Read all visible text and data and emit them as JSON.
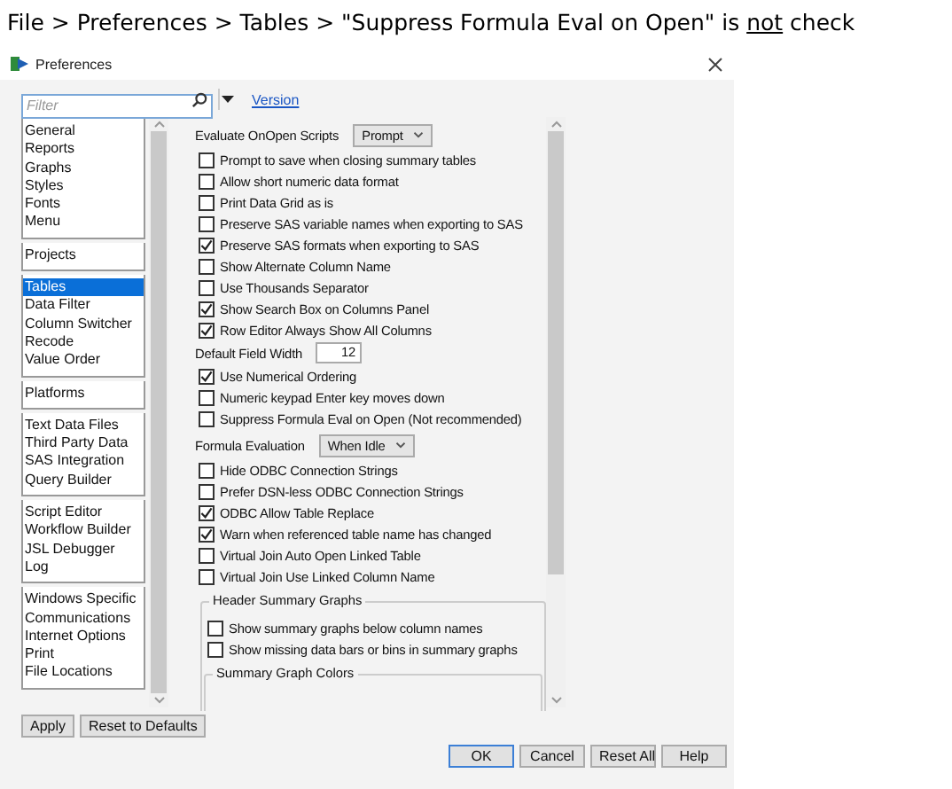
{
  "caption": {
    "before": "File > Preferences > Tables > \"Suppress Formula Eval on Open\" is ",
    "underlined": "not",
    "after": " check"
  },
  "window": {
    "title": "Preferences"
  },
  "filter": {
    "placeholder": "Filter"
  },
  "version_link": "Version",
  "sidebar": {
    "groups": [
      [
        {
          "label": "General",
          "selected": false
        },
        {
          "label": "Reports",
          "selected": false
        },
        {
          "label": "Graphs",
          "selected": false
        },
        {
          "label": "Styles",
          "selected": false
        },
        {
          "label": "Fonts",
          "selected": false
        },
        {
          "label": "Menu",
          "selected": false
        }
      ],
      [
        {
          "label": "Projects",
          "selected": false
        }
      ],
      [
        {
          "label": "Tables",
          "selected": true
        },
        {
          "label": "Data Filter",
          "selected": false
        },
        {
          "label": "Column Switcher",
          "selected": false
        },
        {
          "label": "Recode",
          "selected": false
        },
        {
          "label": "Value Order",
          "selected": false
        }
      ],
      [
        {
          "label": "Platforms",
          "selected": false
        }
      ],
      [
        {
          "label": "Text Data Files",
          "selected": false
        },
        {
          "label": "Third Party Data",
          "selected": false
        },
        {
          "label": "SAS Integration",
          "selected": false
        },
        {
          "label": "Query Builder",
          "selected": false
        }
      ],
      [
        {
          "label": "Script Editor",
          "selected": false
        },
        {
          "label": "Workflow Builder",
          "selected": false
        },
        {
          "label": "JSL Debugger",
          "selected": false
        },
        {
          "label": "Log",
          "selected": false
        }
      ],
      [
        {
          "label": "Windows Specific",
          "selected": false
        },
        {
          "label": "Communications",
          "selected": false
        },
        {
          "label": "Internet Options",
          "selected": false
        },
        {
          "label": "Print",
          "selected": false
        },
        {
          "label": "File Locations",
          "selected": false
        }
      ]
    ]
  },
  "settings": [
    {
      "kind": "dropdown",
      "label": "Evaluate OnOpen Scripts",
      "value": "Prompt"
    },
    {
      "kind": "checkbox",
      "label": "Prompt to save when closing summary tables",
      "checked": false
    },
    {
      "kind": "checkbox",
      "label": "Allow short numeric data format",
      "checked": false
    },
    {
      "kind": "checkbox",
      "label": "Print Data Grid as is",
      "checked": false
    },
    {
      "kind": "checkbox",
      "label": "Preserve SAS variable names when exporting to SAS",
      "checked": false
    },
    {
      "kind": "checkbox",
      "label": "Preserve SAS formats when exporting to SAS",
      "checked": true
    },
    {
      "kind": "checkbox",
      "label": "Show Alternate Column Name",
      "checked": false
    },
    {
      "kind": "checkbox",
      "label": "Use Thousands Separator",
      "checked": false
    },
    {
      "kind": "checkbox",
      "label": "Show Search Box on Columns Panel",
      "checked": true
    },
    {
      "kind": "checkbox",
      "label": "Row Editor Always Show All Columns",
      "checked": true
    },
    {
      "kind": "number",
      "label": "Default Field Width",
      "value": "12"
    },
    {
      "kind": "checkbox",
      "label": "Use Numerical Ordering",
      "checked": true
    },
    {
      "kind": "checkbox",
      "label": "Numeric keypad Enter key moves down",
      "checked": false
    },
    {
      "kind": "checkbox",
      "label": "Suppress Formula Eval on Open (Not recommended)",
      "checked": false
    },
    {
      "kind": "dropdown",
      "label": "Formula Evaluation",
      "value": "When Idle"
    },
    {
      "kind": "checkbox",
      "label": "Hide ODBC Connection Strings",
      "checked": false
    },
    {
      "kind": "checkbox",
      "label": "Prefer DSN-less ODBC Connection Strings",
      "checked": false
    },
    {
      "kind": "checkbox",
      "label": "ODBC Allow Table Replace",
      "checked": true
    },
    {
      "kind": "checkbox",
      "label": "Warn when referenced table name has changed",
      "checked": true
    },
    {
      "kind": "checkbox",
      "label": "Virtual Join Auto Open Linked Table",
      "checked": false
    },
    {
      "kind": "checkbox",
      "label": "Virtual Join Use Linked Column Name",
      "checked": false
    },
    {
      "kind": "group",
      "label": "Header Summary Graphs",
      "children": [
        {
          "kind": "checkbox",
          "label": "Show summary graphs below column names",
          "checked": false
        },
        {
          "kind": "checkbox",
          "label": "Show missing data bars or bins in summary graphs",
          "checked": false
        },
        {
          "kind": "group",
          "label": "Summary Graph Colors"
        }
      ]
    }
  ],
  "left_buttons": [
    "Apply",
    "Reset to Defaults"
  ],
  "bottom_buttons": [
    "OK",
    "Cancel",
    "Reset All",
    "Help"
  ]
}
